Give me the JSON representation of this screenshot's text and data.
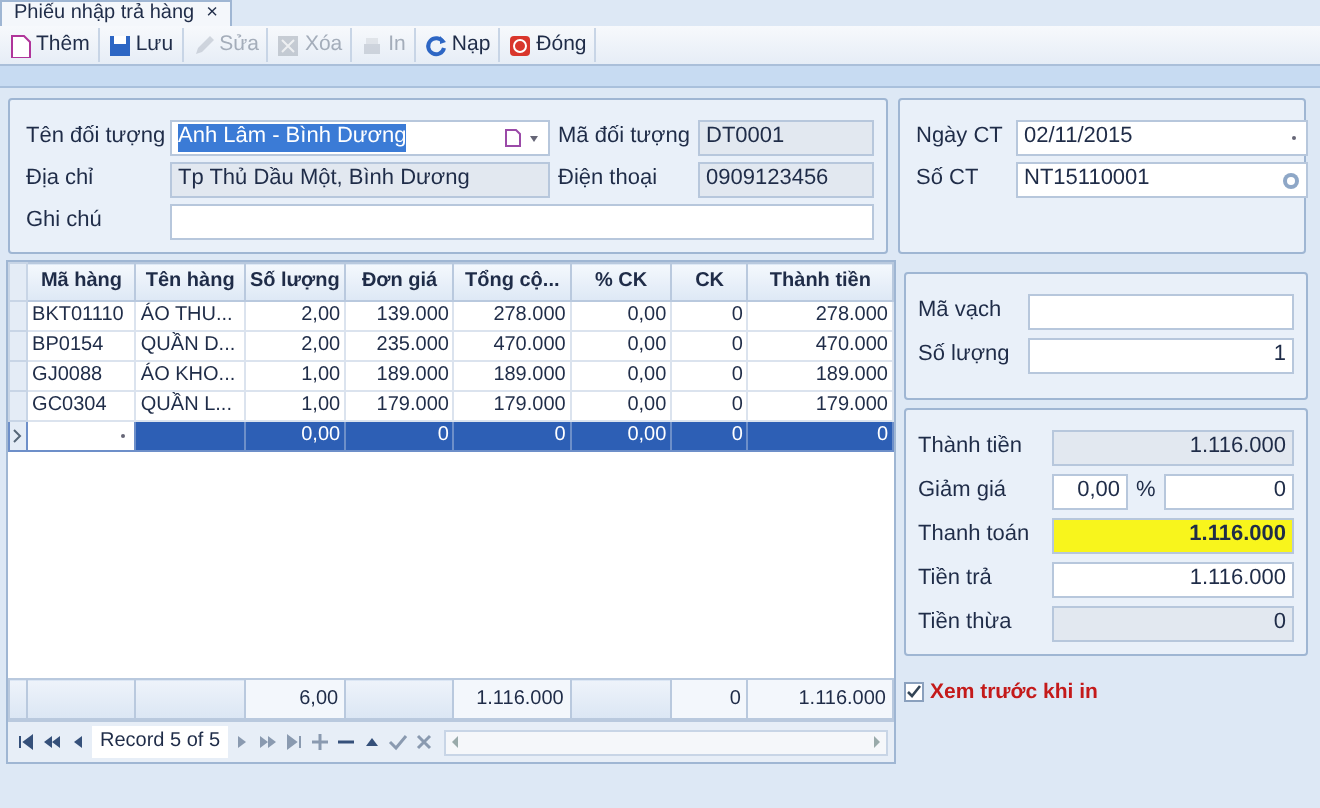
{
  "tab": {
    "title": "Phiếu nhập trả hàng",
    "close": "×"
  },
  "toolbar": [
    {
      "label": "Thêm",
      "disabled": false
    },
    {
      "label": "Lưu",
      "disabled": false
    },
    {
      "label": "Sửa",
      "disabled": true
    },
    {
      "label": "Xóa",
      "disabled": true
    },
    {
      "label": "In",
      "disabled": true
    },
    {
      "label": "Nạp",
      "disabled": false
    },
    {
      "label": "Đóng",
      "disabled": false
    }
  ],
  "customer": {
    "name": {
      "label": "Tên đối tượng",
      "value": "Anh Lâm - Bình Dương",
      "highlighted": true
    },
    "code": {
      "label": "Mã đối tượng",
      "value": "DT0001"
    },
    "address": {
      "label": "Địa chỉ",
      "value": "Tp Thủ Dầu Một, Bình Dương"
    },
    "phone": {
      "label": "Điện thoại",
      "value": "0909123456"
    },
    "note": {
      "label": "Ghi chú"
    }
  },
  "voucher": {
    "date": {
      "label": "Ngày CT",
      "value": "02/11/2015"
    },
    "number": {
      "label": "Số CT",
      "value": "NT15110001"
    }
  },
  "table": {
    "columns": [
      {
        "label": "Mã hàng",
        "kind": "text"
      },
      {
        "label": "Tên hàng",
        "kind": "text"
      },
      {
        "label": "Số lượng",
        "kind": "number"
      },
      {
        "label": "Đơn giá",
        "kind": "number"
      },
      {
        "label": "Tổng cộ...",
        "kind": "number"
      },
      {
        "label": "% CK",
        "kind": "number"
      },
      {
        "label": "CK",
        "kind": "number"
      },
      {
        "label": "Thành tiền",
        "kind": "number"
      }
    ],
    "rows": [
      {
        "selected": false,
        "cells": [
          "BKT01110",
          "ÁO THU...",
          "2,00",
          "139.000",
          "278.000",
          "0,00",
          "0",
          "278.000"
        ]
      },
      {
        "selected": false,
        "cells": [
          "BP0154",
          "QUẦN D...",
          "2,00",
          "235.000",
          "470.000",
          "0,00",
          "0",
          "470.000"
        ]
      },
      {
        "selected": false,
        "cells": [
          "GJ0088",
          "ÁO KHO...",
          "1,00",
          "189.000",
          "189.000",
          "0,00",
          "0",
          "189.000"
        ]
      },
      {
        "selected": false,
        "cells": [
          "GC0304",
          "QUẦN L...",
          "1,00",
          "179.000",
          "179.000",
          "0,00",
          "0",
          "179.000"
        ]
      },
      {
        "selected": true,
        "cells": [
          null,
          null,
          "0,00",
          "0",
          "0",
          "0,00",
          "0",
          "0"
        ]
      }
    ],
    "totals": {
      "quantity": "6,00",
      "total": "1.116.000",
      "discount": "0",
      "amount": "1.116.000"
    }
  },
  "navigator": {
    "record": "Record 5 of 5"
  },
  "scan": {
    "barcode": {
      "label": "Mã vạch"
    },
    "quantity": {
      "label": "Số lượng",
      "value": "1"
    }
  },
  "summary": {
    "subtotal": {
      "label": "Thành tiền",
      "value": "1.116.000"
    },
    "discount": {
      "label": "Giảm giá",
      "percent": "0,00",
      "unit": "%",
      "value": "0"
    },
    "payable": {
      "label": "Thanh toán",
      "value": "1.116.000"
    },
    "paid": {
      "label": "Tiền trả",
      "value": "1.116.000"
    },
    "change": {
      "label": "Tiền thừa",
      "value": "0"
    }
  },
  "preview_before_print": {
    "label": "Xem trước khi in",
    "checked": true
  }
}
